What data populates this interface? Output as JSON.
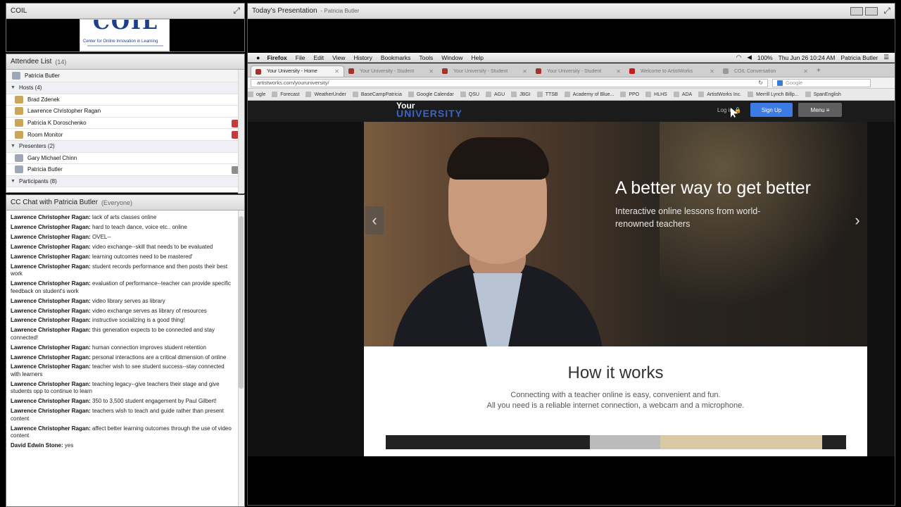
{
  "coil_pod": {
    "title": "COIL",
    "logo_big": "COIL",
    "logo_text": "Center for Online Innovation in Learning"
  },
  "attendees": {
    "title": "Attendee List",
    "count": "(14)",
    "self": "Patricia Butler",
    "hosts_label": "Hosts (4)",
    "hosts": [
      "Brad Zdenek",
      "Lawrence Christopher Ragan",
      "Patricia K Doroschenko",
      "Room Monitor"
    ],
    "presenters_label": "Presenters (2)",
    "presenters": [
      "Gary Michael Chinn",
      "Patricia Butler"
    ],
    "participants_label": "Participants (8)"
  },
  "chat": {
    "title": "CC Chat with Patricia Butler",
    "scope": "(Everyone)",
    "messages": [
      {
        "from": "Lawrence Christopher Ragan:",
        "text": " lack of arts classes online"
      },
      {
        "from": "Lawrence Christopher Ragan:",
        "text": " hard to teach dance, voice etc.. online"
      },
      {
        "from": "Lawrence Christopher Ragan:",
        "text": " OVEL--"
      },
      {
        "from": "Lawrence Christopher Ragan:",
        "text": " video exchange--skill that needs to be evaluated"
      },
      {
        "from": "Lawrence Christopher Ragan:",
        "text": " learning outcomes need to be mastered'"
      },
      {
        "from": "Lawrence Christopher Ragan:",
        "text": " student records performance and then posts their best work"
      },
      {
        "from": "Lawrence Christopher Ragan:",
        "text": " evaluation of performance--teacher can provide specific feedback on student's work"
      },
      {
        "from": "Lawrence Christopher Ragan:",
        "text": " video library serves as library"
      },
      {
        "from": "Lawrence Christopher Ragan:",
        "text": " video exchange serves as library of resources"
      },
      {
        "from": "Lawrence Christopher Ragan:",
        "text": " instructive socializing is a good thing!"
      },
      {
        "from": "Lawrence Christopher Ragan:",
        "text": " this generation expects to be connected and stay connected!"
      },
      {
        "from": "Lawrence Christopher Ragan:",
        "text": " human connection improves student retention"
      },
      {
        "from": "Lawrence Christopher Ragan:",
        "text": " personal interactions are a critical dimension of online"
      },
      {
        "from": "Lawrence Christopher Ragan:",
        "text": " teacher wish to see student success--stay connected with learners"
      },
      {
        "from": "Lawrence Christopher Ragan:",
        "text": " teaching legacy--give teachers their stage and give students opp to continue to learn"
      },
      {
        "from": "Lawrence Christopher Ragan:",
        "text": " 350 to 3,500 student engagement by Paul Gilbert!"
      },
      {
        "from": "Lawrence Christopher Ragan:",
        "text": " teachers wish to teach and guide rather than present content"
      },
      {
        "from": "Lawrence Christopher Ragan:",
        "text": " affect better learning outcomes through the use of video content"
      },
      {
        "from": "David Edwin Stone:",
        "text": " yes"
      }
    ]
  },
  "share_pod": {
    "title": "Today's Presentation",
    "presenter": "- Patricia Butler"
  },
  "mac_menu": {
    "app": "Firefox",
    "items": [
      "File",
      "Edit",
      "View",
      "History",
      "Bookmarks",
      "Tools",
      "Window",
      "Help"
    ],
    "battery": "100%",
    "datetime": "Thu Jun 26  10:24 AM",
    "user": "Patricia Butler"
  },
  "tabs": [
    {
      "label": "Your University - Home",
      "active": true
    },
    {
      "label": "Your University - Student",
      "active": false
    },
    {
      "label": "Your University - Student",
      "active": false
    },
    {
      "label": "Your University - Student",
      "active": false
    },
    {
      "label": "Welcome to ArtistWorks",
      "active": false
    },
    {
      "label": "COIL Conversation",
      "active": false
    }
  ],
  "url": "artistworks.com/youruniversity/",
  "search_placeholder": "Google",
  "bookmarks": [
    "ogle",
    "Forecast",
    "WeatherUnder",
    "BaseCampPatricia",
    "Google Calendar",
    "QSU",
    "AGU",
    "JBGI",
    "TTSB",
    "Academy of Blue...",
    "PPO",
    "HLHS",
    "ADA",
    "ArtistWorks Inc.",
    "Merrill Lynch Billp...",
    "SpanEnglish"
  ],
  "site": {
    "brand_line1": "Your",
    "brand_line2": "UNIVERSITY",
    "login": "Log in",
    "signup": "Sign Up",
    "menu": "Menu ≡",
    "hero_title": "A better way to get better",
    "hero_sub": "Interactive online lessons from world-renowned teachers",
    "how_title": "How it works",
    "how_line1": "Connecting with a teacher online is easy, convenient and fun.",
    "how_line2": "All you need is a reliable internet connection, a webcam and a microphone."
  }
}
